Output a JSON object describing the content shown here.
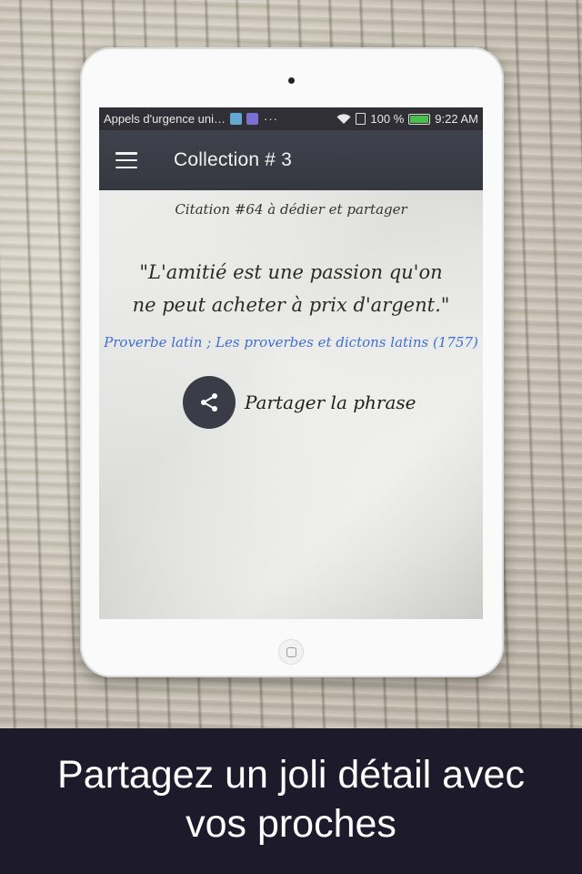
{
  "status_bar": {
    "carrier": "Appels d'urgence uni…",
    "dots": "···",
    "battery": "100 %",
    "time": "9:22 AM"
  },
  "appbar": {
    "title": "Collection # 3"
  },
  "content": {
    "subtitle": "Citation #64 à dédier et partager",
    "quote": "\"L'amitié est une passion qu'on ne peut acheter à prix d'argent.\"",
    "author": "Proverbe latin ; Les proverbes et dictons latins (1757)",
    "share_label": "Partager la phrase"
  },
  "caption": {
    "line1": "Partagez un joli détail avec",
    "line2": "vos proches"
  },
  "colors": {
    "appbar": "#3a3c47",
    "author_link": "#3d6fd2",
    "caption_bg": "#1d1b2b"
  }
}
